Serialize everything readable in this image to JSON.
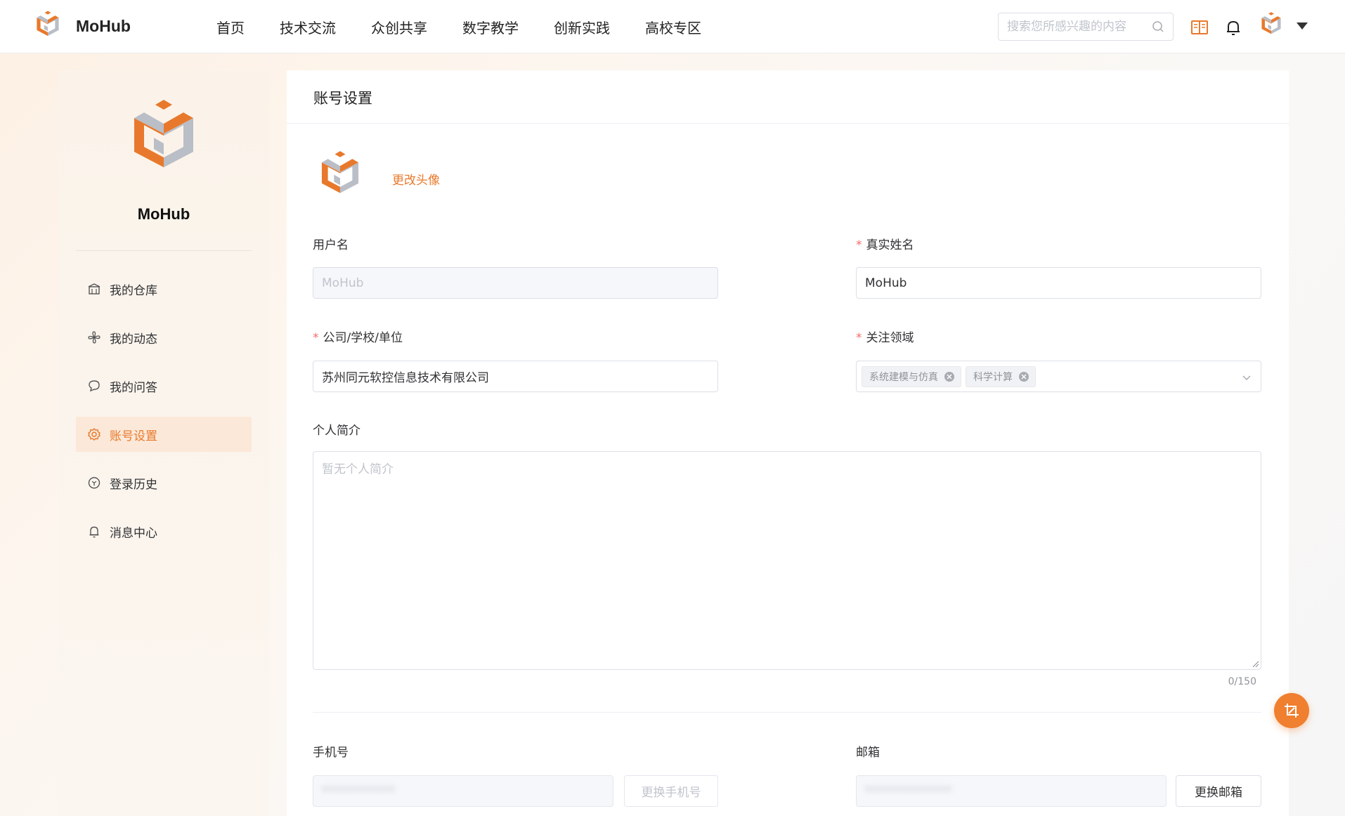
{
  "header": {
    "brand": "MoHub",
    "nav": [
      "首页",
      "技术交流",
      "众创共享",
      "数字教学",
      "创新实践",
      "高校专区"
    ],
    "search_placeholder": "搜索您所感兴趣的内容"
  },
  "sidebar": {
    "name": "MoHub",
    "items": [
      {
        "label": "我的仓库",
        "icon": "warehouse-icon"
      },
      {
        "label": "我的动态",
        "icon": "pinwheel-icon"
      },
      {
        "label": "我的问答",
        "icon": "chat-bubble-icon"
      },
      {
        "label": "账号设置",
        "icon": "gear-icon",
        "active": true
      },
      {
        "label": "登录历史",
        "icon": "history-icon"
      },
      {
        "label": "消息中心",
        "icon": "bell-icon"
      }
    ]
  },
  "main": {
    "title": "账号设置",
    "change_avatar": "更改头像",
    "username_label": "用户名",
    "username_value": "MoHub",
    "realname_label": "真实姓名",
    "realname_value": "MoHub",
    "org_label": "公司/学校/单位",
    "org_value": "苏州同元软控信息技术有限公司",
    "focus_label": "关注领域",
    "focus_tags": [
      "系统建模与仿真",
      "科学计算"
    ],
    "bio_label": "个人简介",
    "bio_placeholder": "暂无个人简介",
    "bio_counter": "0/150",
    "phone_label": "手机号",
    "phone_value": "***********",
    "change_phone": "更换手机号",
    "email_label": "邮箱",
    "email_value": "*************",
    "change_email": "更换邮箱"
  },
  "colors": {
    "accent": "#e8792c",
    "cube_gray": "#b9bec7"
  }
}
